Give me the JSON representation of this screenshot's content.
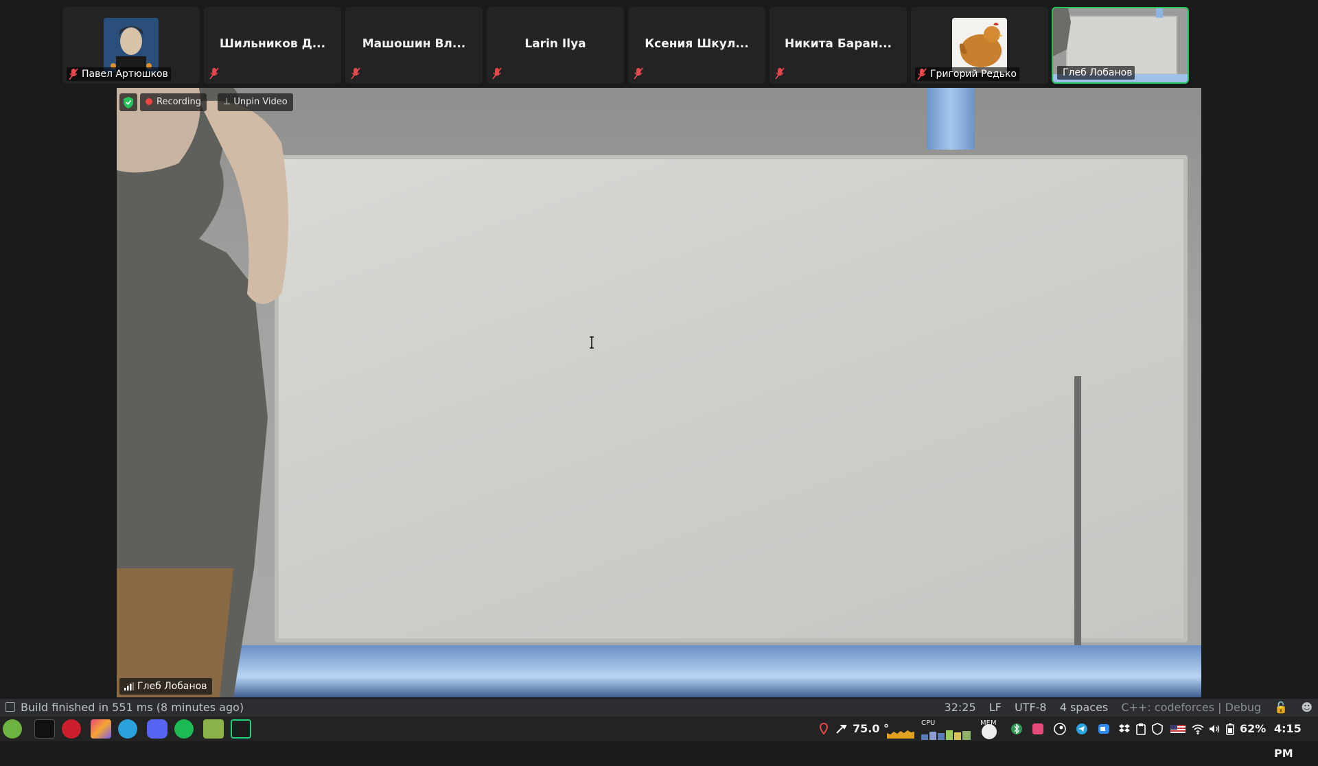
{
  "participants": [
    {
      "name": "Павел Артюшков",
      "has_avatar": true,
      "muted": true
    },
    {
      "name": "Шильников Д...",
      "has_avatar": false,
      "muted": true
    },
    {
      "name": "Машошин Вл...",
      "has_avatar": false,
      "muted": true
    },
    {
      "name": "Larin Ilya",
      "has_avatar": false,
      "muted": true
    },
    {
      "name": "Ксения Шкул...",
      "has_avatar": false,
      "muted": true
    },
    {
      "name": "Никита Баран...",
      "has_avatar": false,
      "muted": true
    },
    {
      "name": "Григорий Редько",
      "has_avatar": true,
      "muted": true
    },
    {
      "name": "Глеб Лобанов",
      "has_avatar": true,
      "muted": false,
      "active_speaker": true
    }
  ],
  "video": {
    "recording_label": "Recording",
    "unpin_label": "Unpin Video",
    "speaker_name": "Глеб Лобанов"
  },
  "statusbar": {
    "build_message": "Build finished in 551 ms (8 minutes ago)",
    "position": "32:25",
    "line_ending": "LF",
    "encoding": "UTF-8",
    "indent": "4 spaces",
    "context": "C++: codeforces | Debug"
  },
  "taskbar": {
    "temperature": "75.0 °",
    "cpu_label": "CPU",
    "mem_label": "MEM",
    "battery": "62%",
    "time": "4:15 PM"
  },
  "colors": {
    "active_border": "#22c55e",
    "recording": "#ef4444",
    "mic_muted": "#e5484d"
  }
}
